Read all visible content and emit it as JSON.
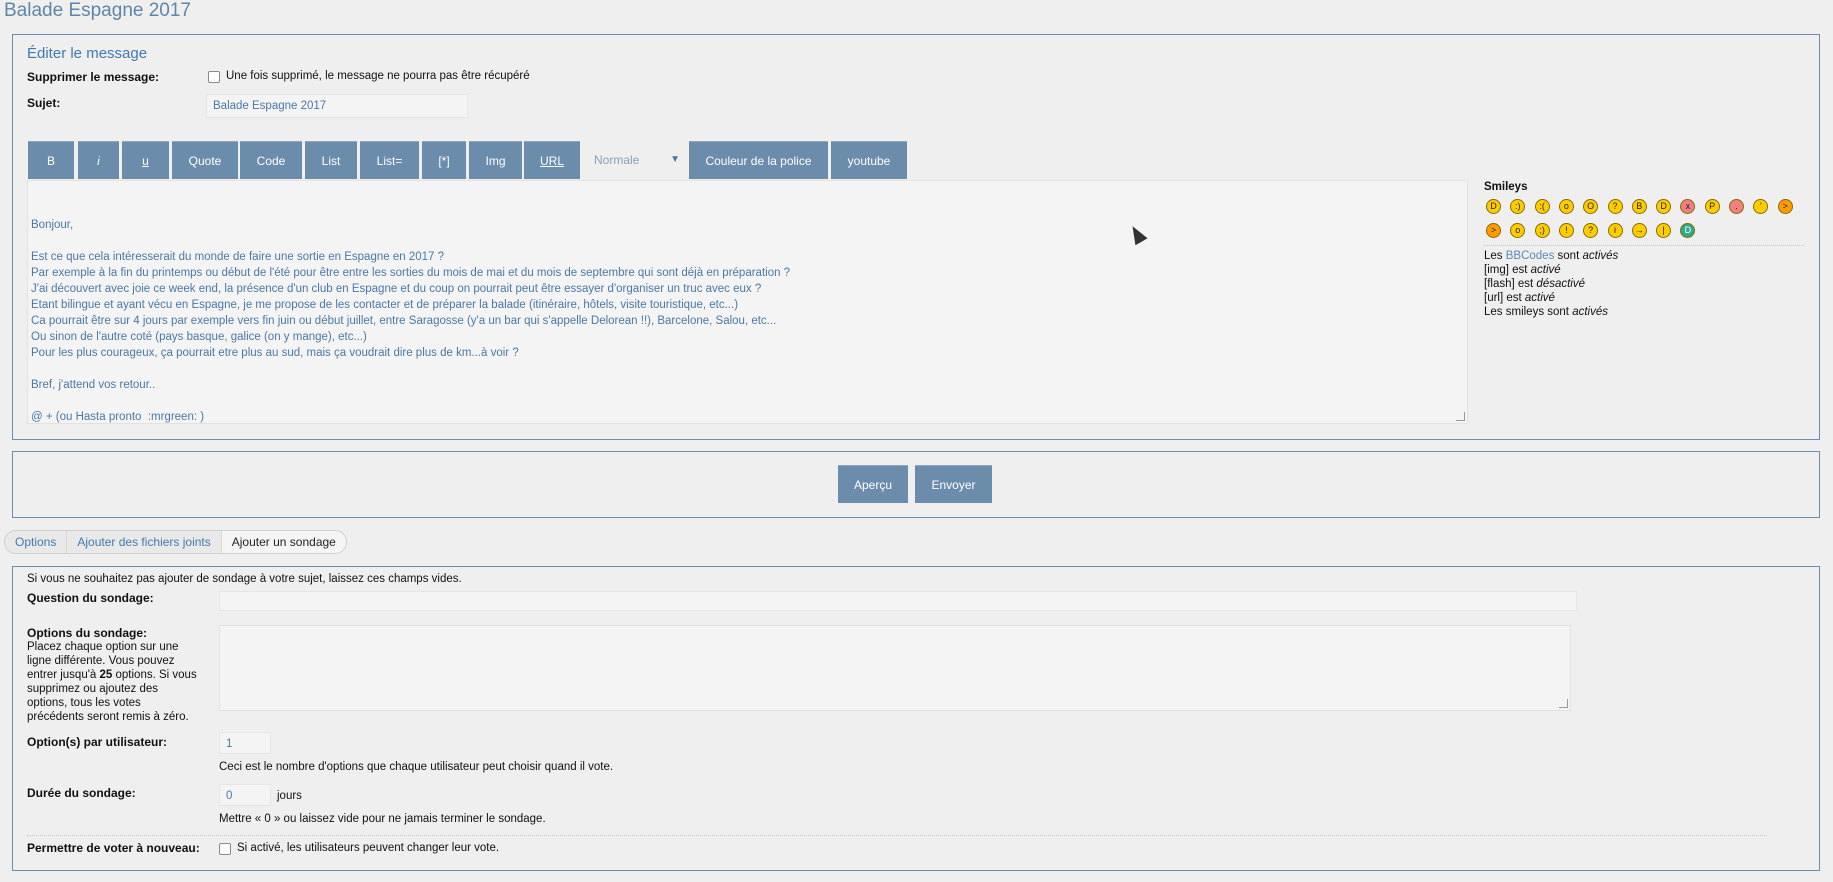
{
  "page": {
    "title": "Balade Espagne 2017"
  },
  "edit": {
    "title": "Éditer le message",
    "delete_label": "Supprimer le message:",
    "delete_hint": "Une fois supprimé, le message ne pourra pas être récupéré",
    "subject_label": "Sujet:",
    "subject_value": "Balade Espagne 2017",
    "toolbar": {
      "bold": "B",
      "italic": "i",
      "underline": "u",
      "quote": "Quote",
      "code": "Code",
      "list": "List",
      "list_eq": "List=",
      "list_item": "[*]",
      "img": "Img",
      "url": "URL",
      "size_select": "Normale",
      "font_color": "Couleur de la police",
      "youtube": "youtube"
    },
    "message_lines": [
      "Bonjour,",
      "",
      "Est ce que cela intéresserait du monde de faire une sortie en Espagne en 2017 ?",
      "Par exemple à la fin du printemps ou début de l'été pour être entre les sorties du mois de mai et du mois de septembre qui sont déjà en préparation ?",
      "J'ai découvert avec joie ce week end, la présence d'un club en Espagne et du coup on pourrait peut être essayer d'organiser un truc avec eux ?",
      "Etant bilingue et ayant vécu en Espagne, je me propose de les contacter et de préparer la balade (itinéraire, hôtels, visite touristique, etc...)",
      "Ca pourrait être sur 4 jours par exemple vers fin juin ou début juillet, entre Saragosse (y'a un bar qui s'appelle Delorean !!), Barcelone, Salou, etc...",
      "Ou sinon de l'autre coté (pays basque, galice (on y mange), etc...)",
      "Pour les plus courageux, ça pourrait etre plus au sud, mais ça voudrait dire plus de km...à voir ?",
      "",
      "Bref, j'attend vos retour..",
      "",
      "@ + (ou Hasta pronto  :mrgreen: )"
    ],
    "smileys_title": "Smileys",
    "info": {
      "bbcode_prefix": "Les ",
      "bbcode_link": "BBCodes",
      "bbcode_suffix": " sont ",
      "bbcode_state": "activés",
      "img_prefix": "[img] est ",
      "img_state": "activé",
      "flash_prefix": "[flash] est ",
      "flash_state": "désactivé",
      "url_prefix": "[url] est ",
      "url_state": "activé",
      "smileys_prefix": "Les smileys sont ",
      "smileys_state": "activés"
    }
  },
  "submit": {
    "preview": "Aperçu",
    "send": "Envoyer"
  },
  "tabs": {
    "options": "Options",
    "attachments": "Ajouter des fichiers joints",
    "poll": "Ajouter un sondage"
  },
  "poll": {
    "intro": "Si vous ne souhaitez pas ajouter de sondage à votre sujet, laissez ces champs vides.",
    "question_label": "Question du sondage:",
    "options_label": "Options du sondage:",
    "options_help_1": "Placez chaque option sur une",
    "options_help_2": "ligne différente. Vous pouvez",
    "options_help_3a": "entrer jusqu'à ",
    "options_help_3b": "25",
    "options_help_3c": " options. Si vous",
    "options_help_4": "supprimez ou ajoutez des",
    "options_help_5": "options, tous les votes",
    "options_help_6": "précédents seront remis à zéro.",
    "per_user_label": "Option(s) par utilisateur:",
    "per_user_value": "1",
    "per_user_help": "Ceci est le nombre d'options que chaque utilisateur peut choisir quand il vote.",
    "duration_label": "Durée du sondage:",
    "duration_value": "0",
    "duration_unit": "jours",
    "duration_help": "Mettre « 0 » ou laissez vide pour ne jamais terminer le sondage.",
    "revote_label": "Permettre de voter à nouveau:",
    "revote_help": "Si activé, les utilisateurs peuvent changer leur vote."
  },
  "smileys": [
    {
      "name": "very-happy-smiley-icon",
      "glyph": "D"
    },
    {
      "name": "smile-smiley-icon",
      "glyph": ":)"
    },
    {
      "name": "sad-smiley-icon",
      "glyph": ":("
    },
    {
      "name": "surprised-smiley-icon",
      "glyph": "o"
    },
    {
      "name": "shocked-smiley-icon",
      "glyph": "O"
    },
    {
      "name": "confused-smiley-icon",
      "glyph": "?"
    },
    {
      "name": "cool-smiley-icon",
      "glyph": "B"
    },
    {
      "name": "laughing-smiley-icon",
      "glyph": "D"
    },
    {
      "name": "mad-smiley-icon",
      "glyph": "x"
    },
    {
      "name": "razz-smiley-icon",
      "glyph": "P"
    },
    {
      "name": "embarrassed-smiley-icon",
      "glyph": "."
    },
    {
      "name": "crying-smiley-icon",
      "glyph": "'"
    },
    {
      "name": "evil-smiley-icon",
      "glyph": ">"
    },
    {
      "name": "twisted-evil-smiley-icon",
      "glyph": ">"
    },
    {
      "name": "rolling-eyes-smiley-icon",
      "glyph": "o"
    },
    {
      "name": "wink-smiley-icon",
      "glyph": ";)"
    },
    {
      "name": "exclaim-smiley-icon",
      "glyph": "!"
    },
    {
      "name": "question-smiley-icon",
      "glyph": "?"
    },
    {
      "name": "idea-smiley-icon",
      "glyph": "i"
    },
    {
      "name": "arrow-smiley-icon",
      "glyph": "→"
    },
    {
      "name": "neutral-smiley-icon",
      "glyph": "|"
    },
    {
      "name": "mr-green-smiley-icon",
      "glyph": "D"
    }
  ]
}
